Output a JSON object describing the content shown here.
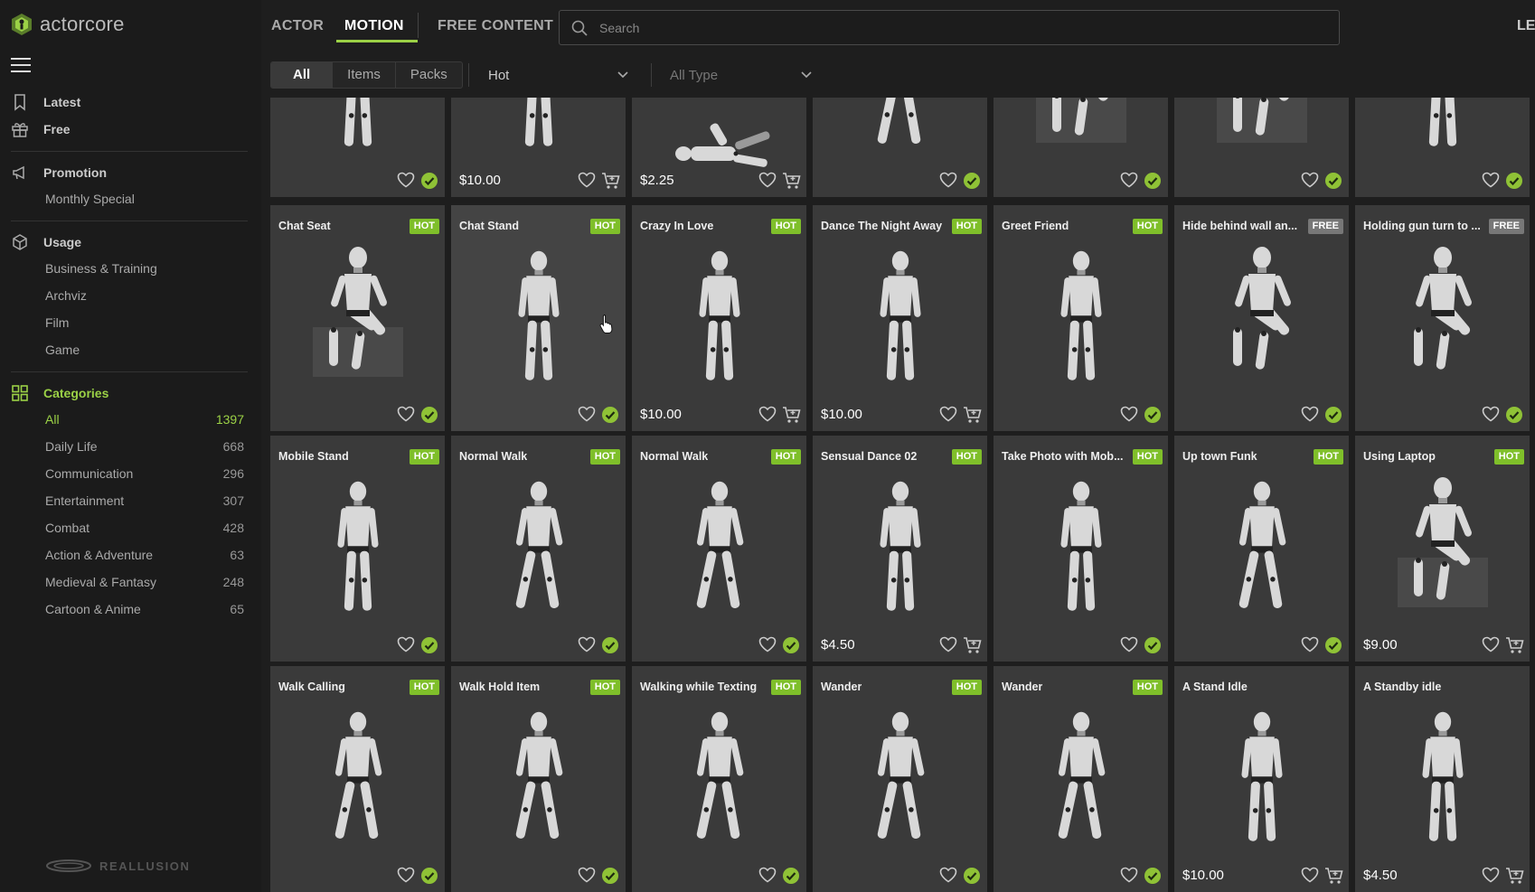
{
  "brand": {
    "name": "actorcore",
    "footer": "REALLUSION"
  },
  "topnav": {
    "tabs": [
      {
        "label": "ACTOR"
      },
      {
        "label": "MOTION"
      },
      {
        "label": "FREE CONTENT"
      }
    ],
    "active": "MOTION",
    "right_label": "LE"
  },
  "search": {
    "placeholder": "Search",
    "value": ""
  },
  "sidebar": {
    "latest": "Latest",
    "free": "Free",
    "promotion": "Promotion",
    "promotion_items": [
      "Monthly Special"
    ],
    "usage": "Usage",
    "usage_items": [
      "Business & Training",
      "Archviz",
      "Film",
      "Game"
    ],
    "categories_title": "Categories",
    "categories": [
      {
        "label": "All",
        "count": "1397"
      },
      {
        "label": "Daily Life",
        "count": "668"
      },
      {
        "label": "Communication",
        "count": "296"
      },
      {
        "label": "Entertainment",
        "count": "307"
      },
      {
        "label": "Combat",
        "count": "428"
      },
      {
        "label": "Action & Adventure",
        "count": "63"
      },
      {
        "label": "Medieval & Fantasy",
        "count": "248"
      },
      {
        "label": "Cartoon & Anime",
        "count": "65"
      }
    ],
    "active_category": "All"
  },
  "filters": {
    "segments": [
      "All",
      "Items",
      "Packs"
    ],
    "active_segment": "All",
    "sort": "Hot",
    "type": "All Type"
  },
  "grid": {
    "rows": [
      [
        {
          "title": "",
          "badge": "",
          "price": "",
          "action": "owned",
          "pose": "stand"
        },
        {
          "title": "",
          "badge": "",
          "price": "$10.00",
          "action": "cart",
          "pose": "stand"
        },
        {
          "title": "",
          "badge": "",
          "price": "$2.25",
          "action": "cart",
          "pose": "lying"
        },
        {
          "title": "",
          "badge": "",
          "price": "",
          "action": "owned",
          "pose": "lunge"
        },
        {
          "title": "",
          "badge": "",
          "price": "",
          "action": "owned",
          "pose": "sit"
        },
        {
          "title": "",
          "badge": "",
          "price": "",
          "action": "owned",
          "pose": "sit"
        },
        {
          "title": "",
          "badge": "",
          "price": "",
          "action": "owned",
          "pose": "stand"
        }
      ],
      [
        {
          "title": "Chat Seat",
          "badge": "HOT",
          "price": "",
          "action": "owned",
          "pose": "sit"
        },
        {
          "title": "Chat Stand",
          "badge": "HOT",
          "price": "",
          "action": "owned",
          "pose": "stand"
        },
        {
          "title": "Crazy In Love",
          "badge": "HOT",
          "price": "$10.00",
          "action": "cart",
          "pose": "stand"
        },
        {
          "title": "Dance The Night Away",
          "badge": "HOT",
          "price": "$10.00",
          "action": "cart",
          "pose": "stand"
        },
        {
          "title": "Greet Friend",
          "badge": "HOT",
          "price": "",
          "action": "owned",
          "pose": "stand"
        },
        {
          "title": "Hide behind wall an...",
          "badge": "FREE",
          "price": "",
          "action": "owned",
          "pose": "crouch"
        },
        {
          "title": "Holding gun turn to ...",
          "badge": "FREE",
          "price": "",
          "action": "owned",
          "pose": "crouch"
        }
      ],
      [
        {
          "title": "Mobile Stand",
          "badge": "HOT",
          "price": "",
          "action": "owned",
          "pose": "stand"
        },
        {
          "title": "Normal Walk",
          "badge": "HOT",
          "price": "",
          "action": "owned",
          "pose": "walk"
        },
        {
          "title": "Normal Walk",
          "badge": "HOT",
          "price": "",
          "action": "owned",
          "pose": "walk"
        },
        {
          "title": "Sensual Dance 02",
          "badge": "HOT",
          "price": "$4.50",
          "action": "cart",
          "pose": "stand"
        },
        {
          "title": "Take Photo with Mob...",
          "badge": "HOT",
          "price": "",
          "action": "owned",
          "pose": "stand"
        },
        {
          "title": "Up town Funk",
          "badge": "HOT",
          "price": "",
          "action": "owned",
          "pose": "walk"
        },
        {
          "title": "Using Laptop",
          "badge": "HOT",
          "price": "$9.00",
          "action": "cart",
          "pose": "sit"
        }
      ],
      [
        {
          "title": "Walk Calling",
          "badge": "HOT",
          "price": "",
          "action": "owned",
          "pose": "walk"
        },
        {
          "title": "Walk Hold Item",
          "badge": "HOT",
          "price": "",
          "action": "owned",
          "pose": "walk"
        },
        {
          "title": "Walking while Texting",
          "badge": "HOT",
          "price": "",
          "action": "owned",
          "pose": "walk"
        },
        {
          "title": "Wander",
          "badge": "HOT",
          "price": "",
          "action": "owned",
          "pose": "walk"
        },
        {
          "title": "Wander",
          "badge": "HOT",
          "price": "",
          "action": "owned",
          "pose": "walk"
        },
        {
          "title": "A Stand Idle",
          "badge": "",
          "price": "$10.00",
          "action": "cart",
          "pose": "stand"
        },
        {
          "title": "A Standby idle",
          "badge": "",
          "price": "$4.50",
          "action": "cart",
          "pose": "stand"
        }
      ]
    ]
  },
  "colors": {
    "accent": "#9bd146",
    "hot": "#7fbf2a",
    "free": "#777777",
    "card": "#3a3a3a"
  }
}
